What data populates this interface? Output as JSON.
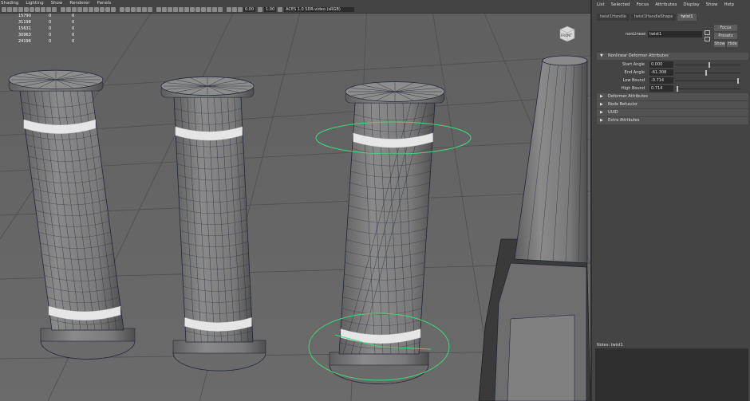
{
  "viewport": {
    "menu": [
      "Shading",
      "Lighting",
      "Show",
      "Renderer",
      "Panels"
    ],
    "toolbar": {
      "exposure_value": "0.00",
      "gamma_value": "1.00",
      "colorspace": "ACES 1.0 SDR-video (sRGB)"
    },
    "stats": [
      {
        "a": "15790",
        "b": "0",
        "c": "0"
      },
      {
        "a": "31198",
        "b": "0",
        "c": "0"
      },
      {
        "a": "15631",
        "b": "0",
        "c": "0"
      },
      {
        "a": "30963",
        "b": "0",
        "c": "0"
      },
      {
        "a": "24196",
        "b": "0",
        "c": "0"
      }
    ],
    "viewcube_label": "FRONT",
    "colors": {
      "background": "#666666",
      "mesh_fill": "#7a7a7a",
      "wire": "#1f2636",
      "band": "#e6e6e6",
      "manipulator": "#3ed97c"
    }
  },
  "panel": {
    "menu": [
      "List",
      "Selected",
      "Focus",
      "Attributes",
      "Display",
      "Show",
      "Help"
    ],
    "tabs": [
      "twist1Handle",
      "twist1HandleShape",
      "twist1"
    ],
    "active_tab": 2,
    "node_label": "nonLinear:",
    "node_value": "twist1",
    "focus_label": "Focus",
    "presets_label": "Presets",
    "show_label": "Show",
    "hide_label": "Hide",
    "nonlinear_header": "Nonlinear Deformer Attributes",
    "attributes": [
      {
        "label": "Start Angle",
        "value": "0.000",
        "fraction": 0.52
      },
      {
        "label": "End Angle",
        "value": "-61.308",
        "fraction": 0.47
      },
      {
        "label": "Low Bound",
        "value": "-0.714",
        "fraction": 0.97
      },
      {
        "label": "High Bound",
        "value": "0.714",
        "fraction": 0.03
      }
    ],
    "sections": [
      "Deformer Attributes",
      "Node Behavior",
      "UUID",
      "Extra Attributes"
    ],
    "notes_label": "Notes: twist1"
  }
}
